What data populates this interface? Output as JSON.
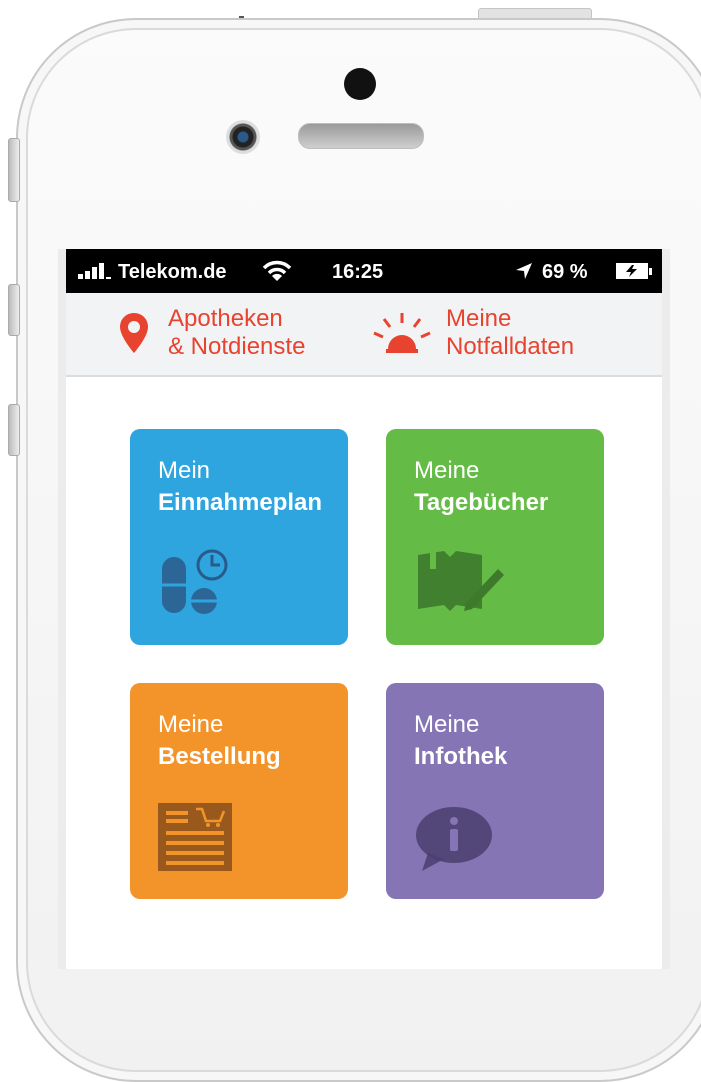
{
  "status_bar": {
    "carrier": "Telekom.de",
    "time": "16:25",
    "battery": "69 %"
  },
  "top_nav": {
    "pharmacies_line1": "Apotheken",
    "pharmacies_line2": "& Notdienste",
    "emergency_line1": "Meine",
    "emergency_line2": "Notfalldaten"
  },
  "tiles": [
    {
      "line1": "Mein",
      "line2": "Einnahmeplan",
      "color": "#2ea5de",
      "icon": "pill-clock-icon"
    },
    {
      "line1": "Meine",
      "line2": "Tagebücher",
      "color": "#64bb46",
      "icon": "book-pen-icon"
    },
    {
      "line1": "Meine",
      "line2": "Bestellung",
      "color": "#f3942b",
      "icon": "order-form-cart-icon"
    },
    {
      "line1": "Meine",
      "line2": "Infothek",
      "color": "#8575b5",
      "icon": "info-bubble-icon"
    }
  ],
  "colors": {
    "accent_red": "#e8432f"
  }
}
